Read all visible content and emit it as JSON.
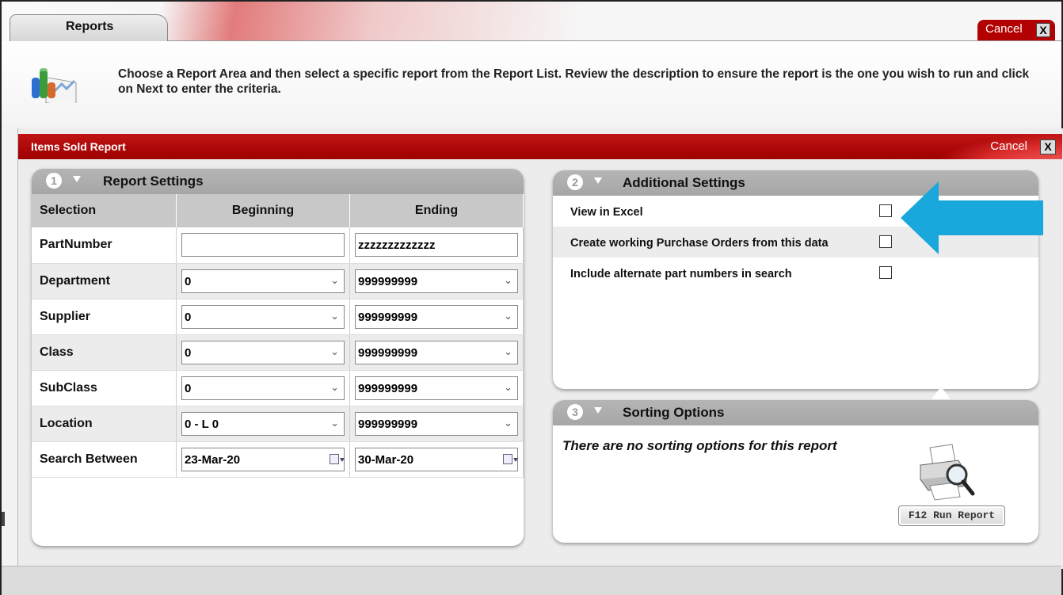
{
  "top_tab": {
    "label": "Reports"
  },
  "top_cancel": {
    "label": "Cancel",
    "close": "X"
  },
  "header": {
    "instruction": "Choose a Report Area and then select a specific report from the Report List. Review the description to ensure the report is the one you wish to run and click on Next to enter the criteria."
  },
  "dialog": {
    "title": "Items Sold Report",
    "cancel_label": "Cancel",
    "close": "X"
  },
  "report_settings": {
    "step": "1",
    "title": "Report Settings",
    "columns": [
      "Selection",
      "Beginning",
      "Ending"
    ],
    "rows": [
      {
        "label": "PartNumber",
        "begin": "",
        "end": "zzzzzzzzzzzzz"
      },
      {
        "label": "Department",
        "begin": "0",
        "end": "999999999"
      },
      {
        "label": "Supplier",
        "begin": "0",
        "end": "999999999"
      },
      {
        "label": "Class",
        "begin": "0",
        "end": "999999999"
      },
      {
        "label": "SubClass",
        "begin": "0",
        "end": "999999999"
      },
      {
        "label": "Location",
        "begin": "0 - L 0",
        "end": "999999999"
      },
      {
        "label": "Search Between",
        "begin": "23-Mar-20",
        "end": "30-Mar-20"
      }
    ]
  },
  "additional_settings": {
    "step": "2",
    "title": "Additional Settings",
    "options": [
      {
        "label": "View in Excel",
        "checked": false
      },
      {
        "label": "Create working Purchase Orders from this data",
        "checked": false
      },
      {
        "label": "Include alternate part numbers in search",
        "checked": false
      }
    ]
  },
  "sorting_options": {
    "step": "3",
    "title": "Sorting Options",
    "message": "There are no sorting options for this report",
    "run_button": "F12 Run Report"
  },
  "icons": {
    "header": "report-chart-icon",
    "printer": "printer-magnifier-icon",
    "select": "chevron-down-icon",
    "date": "calendar-icon",
    "annotation": "blue-arrow-left"
  },
  "colors": {
    "accent_red": "#b30000",
    "arrow_blue": "#1aa7dc",
    "panel_header": "#aaaaaa"
  }
}
